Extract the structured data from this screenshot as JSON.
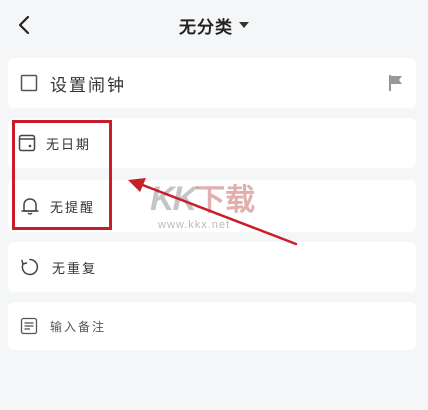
{
  "header": {
    "title": "无分类"
  },
  "alarm": {
    "label": "设置闹钟"
  },
  "date": {
    "label": "无日期"
  },
  "reminder": {
    "label": "无提醒"
  },
  "repeat": {
    "label": "无重复"
  },
  "note": {
    "placeholder": "输入备注"
  },
  "watermark": {
    "logo": "KK",
    "logo_cn": "下载",
    "url": "www.kkx.net"
  },
  "colors": {
    "highlight": "#c81e2a",
    "background": "#f5f6f8",
    "card": "#ffffff"
  }
}
